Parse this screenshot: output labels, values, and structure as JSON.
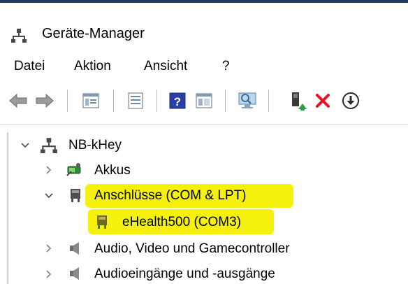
{
  "window": {
    "title": "Geräte-Manager"
  },
  "menu": [
    "Datei",
    "Aktion",
    "Ansicht",
    "?"
  ],
  "toolbar": {
    "buttons": [
      "back-icon",
      "forward-icon",
      "properties-icon",
      "list-view-icon",
      "help-icon",
      "details-view-icon",
      "scan-hardware-icon",
      "update-driver-icon",
      "uninstall-icon",
      "download-icon"
    ]
  },
  "tree": {
    "root": "NB-kHey",
    "items": [
      {
        "label": "Akkus",
        "expanded": false,
        "icon": "battery-icon"
      },
      {
        "label": "Anschlüsse (COM & LPT)",
        "expanded": true,
        "icon": "port-icon",
        "highlight": true,
        "children": [
          {
            "label": "eHealth500 (COM3)",
            "icon": "port-icon",
            "highlight": true
          }
        ]
      },
      {
        "label": "Audio, Video und Gamecontroller",
        "expanded": false,
        "icon": "speaker-icon"
      },
      {
        "label": "Audioeingänge und -ausgänge",
        "expanded": false,
        "icon": "speaker-icon"
      }
    ]
  },
  "colors": {
    "highlight": "#f4f000",
    "accent": "#1f3a5f",
    "delete": "#e81123"
  }
}
